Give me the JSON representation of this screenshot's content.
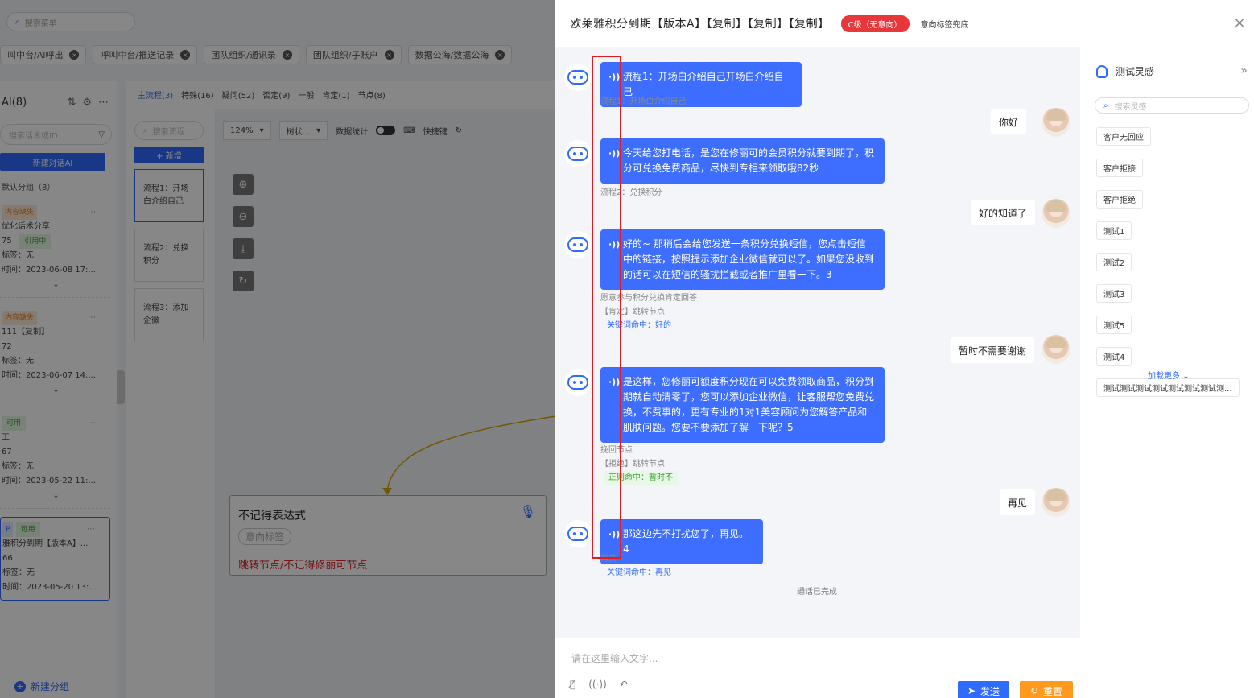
{
  "bg": {
    "search_placeholder": "搜索菜单",
    "tabs": [
      "叫中台/AI呼出",
      "呼叫中台/推送记录",
      "团队组织/通讯录",
      "团队组织/子账户",
      "数据公海/数据公海"
    ],
    "left": {
      "header": "AI(8)",
      "search_placeholder": "搜索话术或ID",
      "new_button": "新建对话AI",
      "group": "默认分组（8）",
      "cards": [
        {
          "tag": "内容缺失",
          "name": "优化话术分享",
          "id": "75",
          "status": "引用中",
          "label": "标签：无",
          "time": "时间：2023-06-08 17:..."
        },
        {
          "tag": "内容缺失",
          "name": "111【复制】",
          "id": "72",
          "status": "",
          "label": "标签：无",
          "time": "时间：2023-06-07 14:..."
        },
        {
          "tag": "可用",
          "name": "工",
          "id": "67",
          "status": "",
          "label": "标签：无",
          "time": "时间：2023-05-22 11:..."
        },
        {
          "tag": "P",
          "tag2": "可用",
          "name": "雅积分到期【版本A】...",
          "id": "66",
          "status": "",
          "label": "标签：无",
          "time": "时间：2023-05-20 13:..."
        }
      ],
      "new_group": "新建分组"
    },
    "mid": {
      "tabs": [
        "主流程(3)",
        "特殊(16)",
        "疑问(52)",
        "否定(9)",
        "一般",
        "肯定(1)",
        "节点(8)"
      ],
      "search_placeholder": "搜索流程",
      "add_button": "+ 新增",
      "flows": [
        "流程1：开场白介绍自己",
        "流程2：兑换积分",
        "流程3：添加企微"
      ],
      "zoom": "124%",
      "tree_select": "树状...",
      "stats_label": "数据统计",
      "shortcut_label": "快捷键",
      "node": {
        "title": "不记得表达式",
        "tag": "意向标签",
        "jump": "跳转节点/不记得修丽可节点"
      }
    }
  },
  "drawer": {
    "title": "欧莱雅积分到期【版本A】【复制】【复制】【复制】",
    "badge": "C级（无意向）",
    "subtitle": "意向标签兜底",
    "close": "×",
    "messages": [
      {
        "role": "bot",
        "text": "流程1：开场白介绍自己开场白介绍自己",
        "meta": [
          "流程1：开场白介绍自己"
        ]
      },
      {
        "role": "user",
        "text": "你好"
      },
      {
        "role": "bot",
        "text": "今天给您打电话，是您在修丽可的会员积分就要到期了，积分可兑换免费商品，尽快到专柜来领取哦82秒",
        "meta": [
          "流程2：兑换积分"
        ]
      },
      {
        "role": "user",
        "text": "好的知道了"
      },
      {
        "role": "bot",
        "text": "好的~ 那稍后会给您发送一条积分兑换短信，您点击短信中的链接，按照提示添加企业微信就可以了。如果您没收到的话可以在短信的骚扰拦截或者推广里看一下。3",
        "meta": [
          "愿意参与积分兑换肯定回答",
          "【肯定】跳转节点"
        ],
        "keyword": "关键词命中：好的"
      },
      {
        "role": "user",
        "text": "暂时不需要谢谢"
      },
      {
        "role": "bot",
        "text": "是这样，您修丽可额度积分现在可以免费领取商品，积分到期就自动清零了，您可以添加企业微信，让客服帮您免费兑换，不费事的，更有专业的1对1美容顾问为您解答产品和肌肤问题。您要不要添加了解一下呢？5",
        "meta": [
          "挽回节点",
          "【拒绝】跳转节点"
        ],
        "keyword": "正则命中：暂时不"
      },
      {
        "role": "user",
        "text": "再见"
      },
      {
        "role": "bot",
        "text": "那这边先不打扰您了，再见。4",
        "meta": [
          "再见"
        ],
        "keyword": "关键词命中：再见"
      }
    ],
    "done": "通话已完成",
    "input_placeholder": "请在这里输入文字...",
    "send": "发送",
    "reset": "重置",
    "side": {
      "title": "测试灵感",
      "search_placeholder": "搜索灵感",
      "items": [
        "客户无回应",
        "客户拒接",
        "客户拒绝",
        "测试1",
        "测试2",
        "测试3",
        "测试5",
        "测试4",
        "测试测试测试测试测试测试测试测..."
      ],
      "more": "加载更多"
    }
  },
  "colors": {
    "primary": "#2f6bff",
    "danger": "#e8373a",
    "warning": "#ff9a1f",
    "highlight_box": "#e8181e"
  }
}
